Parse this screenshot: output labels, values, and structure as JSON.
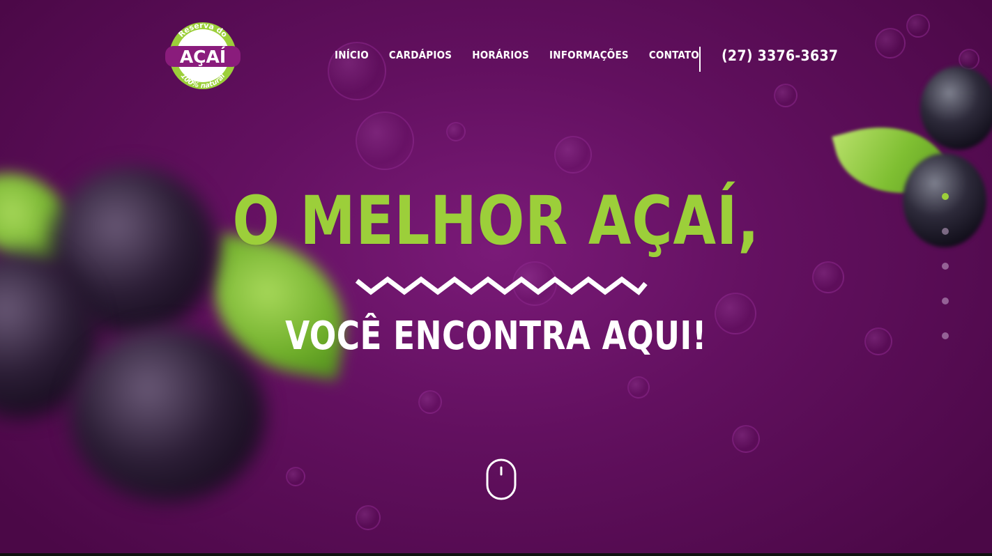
{
  "logo": {
    "top_text": "Reserva do",
    "main_text": "AÇAÍ",
    "bottom_text": "100% natural"
  },
  "nav": {
    "items": [
      {
        "label": "INÍCIO"
      },
      {
        "label": "CARDÁPIOS"
      },
      {
        "label": "HORÁRIOS"
      },
      {
        "label": "INFORMAÇÕES"
      },
      {
        "label": "CONTATO"
      }
    ],
    "phone": "(27) 3376-3637"
  },
  "hero": {
    "title": "O MELHOR AÇAÍ,",
    "subtitle": "VOCÊ ENCONTRA AQUI!"
  },
  "pager": {
    "count": 5,
    "active_index": 0
  },
  "colors": {
    "brand_purple": "#62105f",
    "accent_green": "#9ccf3a",
    "text_white": "#ffffff"
  },
  "icons": {
    "scroll": "mouse-scroll-icon"
  }
}
